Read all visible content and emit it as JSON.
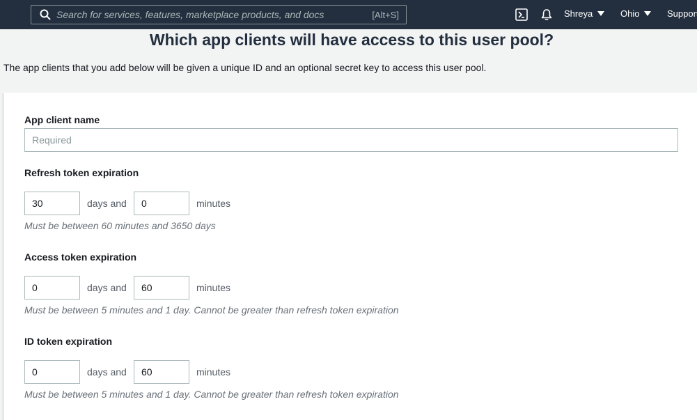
{
  "topbar": {
    "search_placeholder": "Search for services, features, marketplace products, and docs",
    "search_shortcut": "[Alt+S]",
    "user_name": "Shreya",
    "region": "Ohio",
    "support": "Support"
  },
  "page": {
    "title": "Which app clients will have access to this user pool?",
    "description": "The app clients that you add below will be given a unique ID and an optional secret key to access this user pool."
  },
  "form": {
    "app_client_name": {
      "label": "App client name",
      "placeholder": "Required",
      "value": ""
    },
    "refresh_token": {
      "label": "Refresh token expiration",
      "days": "30",
      "minutes": "0",
      "days_and_text": "days and",
      "minutes_text": "minutes",
      "hint": "Must be between 60 minutes and 3650 days"
    },
    "access_token": {
      "label": "Access token expiration",
      "days": "0",
      "minutes": "60",
      "days_and_text": "days and",
      "minutes_text": "minutes",
      "hint": "Must be between 5 minutes and 1 day. Cannot be greater than refresh token expiration"
    },
    "id_token": {
      "label": "ID token expiration",
      "days": "0",
      "minutes": "60",
      "days_and_text": "days and",
      "minutes_text": "minutes",
      "hint": "Must be between 5 minutes and 1 day. Cannot be greater than refresh token expiration"
    }
  },
  "colors": {
    "topbar_bg": "#232f3e",
    "page_bg": "#f2f3f3",
    "card_bg": "#ffffff"
  },
  "icons": [
    "search-icon",
    "cloudshell-icon",
    "bell-icon",
    "caret-down-icon"
  ]
}
